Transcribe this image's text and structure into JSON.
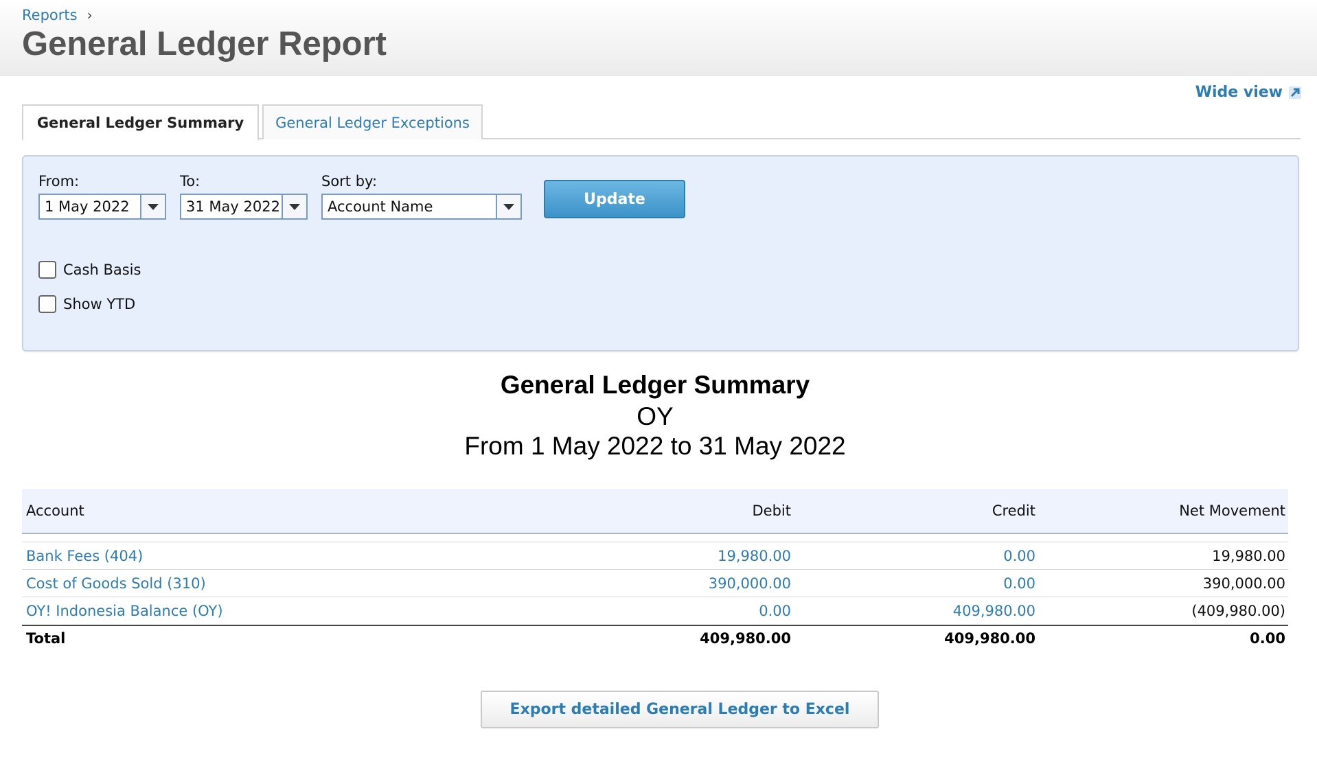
{
  "breadcrumb": {
    "reports": "Reports",
    "separator": "›"
  },
  "page_title": "General Ledger Report",
  "wide_view": {
    "label": "Wide view",
    "icon": "expand-arrow-icon"
  },
  "tabs": [
    {
      "label": "General Ledger Summary",
      "active": true
    },
    {
      "label": "General Ledger Exceptions",
      "active": false
    }
  ],
  "filters": {
    "from_label": "From:",
    "from_value": "1 May 2022",
    "to_label": "To:",
    "to_value": "31 May 2022",
    "sort_label": "Sort by:",
    "sort_value": "Account Name",
    "update_label": "Update",
    "cash_basis_label": "Cash Basis",
    "cash_basis_checked": false,
    "show_ytd_label": "Show YTD",
    "show_ytd_checked": false
  },
  "report": {
    "title": "General Ledger Summary",
    "organisation": "OY",
    "period": "From 1 May 2022 to 31 May 2022"
  },
  "table": {
    "headers": {
      "account": "Account",
      "debit": "Debit",
      "credit": "Credit",
      "net": "Net Movement"
    },
    "rows": [
      {
        "account": "Bank Fees (404)",
        "debit": "19,980.00",
        "credit": "0.00",
        "net": "19,980.00"
      },
      {
        "account": "Cost of Goods Sold (310)",
        "debit": "390,000.00",
        "credit": "0.00",
        "net": "390,000.00"
      },
      {
        "account": "OY! Indonesia Balance (OY)",
        "debit": "0.00",
        "credit": "409,980.00",
        "net": "(409,980.00)"
      }
    ],
    "total": {
      "label": "Total",
      "debit": "409,980.00",
      "credit": "409,980.00",
      "net": "0.00"
    }
  },
  "export_label": "Export detailed General Ledger to Excel",
  "colors": {
    "link": "#2d7db3",
    "panel": "#e8effc",
    "button": "#3c93c8"
  }
}
